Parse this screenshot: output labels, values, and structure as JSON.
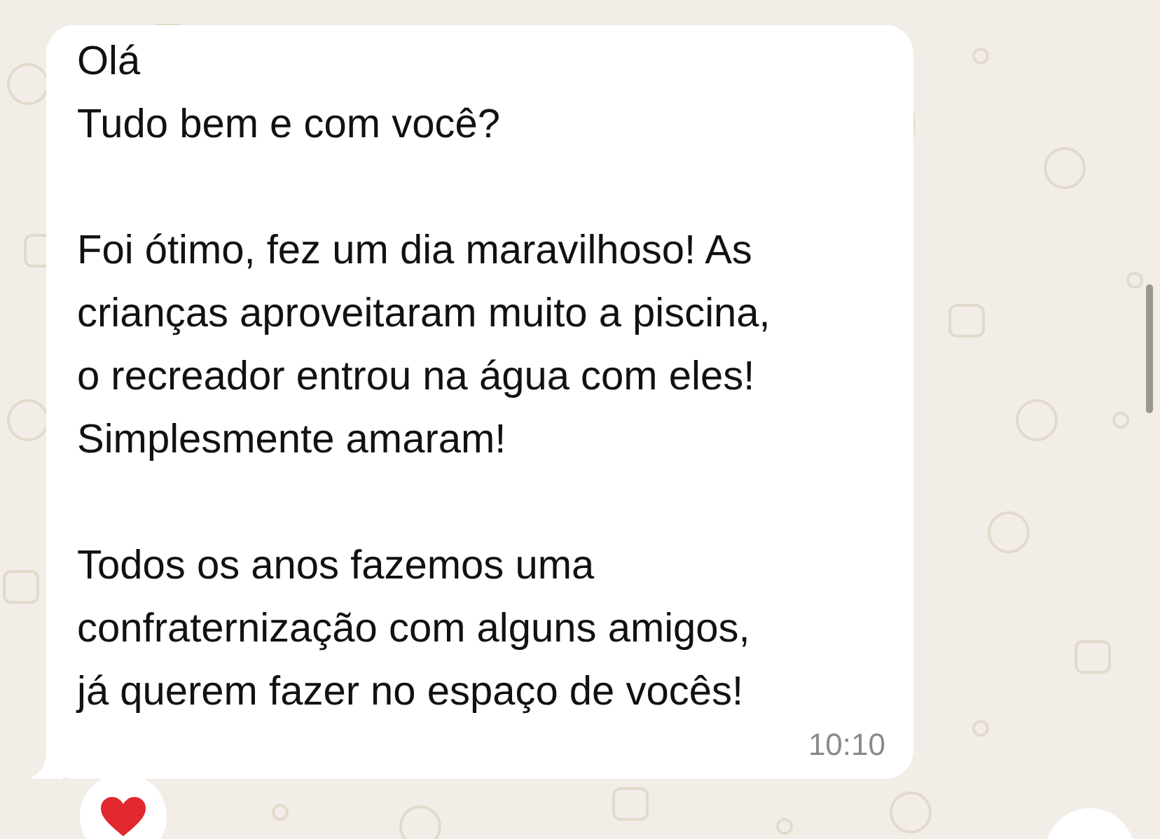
{
  "message": {
    "paragraphs": [
      [
        "Olá",
        "Tudo bem e com você?"
      ],
      [
        "Foi ótimo, fez um dia maravilhoso! As",
        "crianças aproveitaram muito a piscina,",
        "o recreador entrou na água com eles!",
        "Simplesmente amaram!"
      ],
      [
        "Todos os anos fazemos uma",
        "confraternização com alguns amigos,",
        "já querem fazer no espaço de vocês!"
      ]
    ],
    "time": "10:10",
    "reaction": {
      "kind": "heart"
    }
  }
}
